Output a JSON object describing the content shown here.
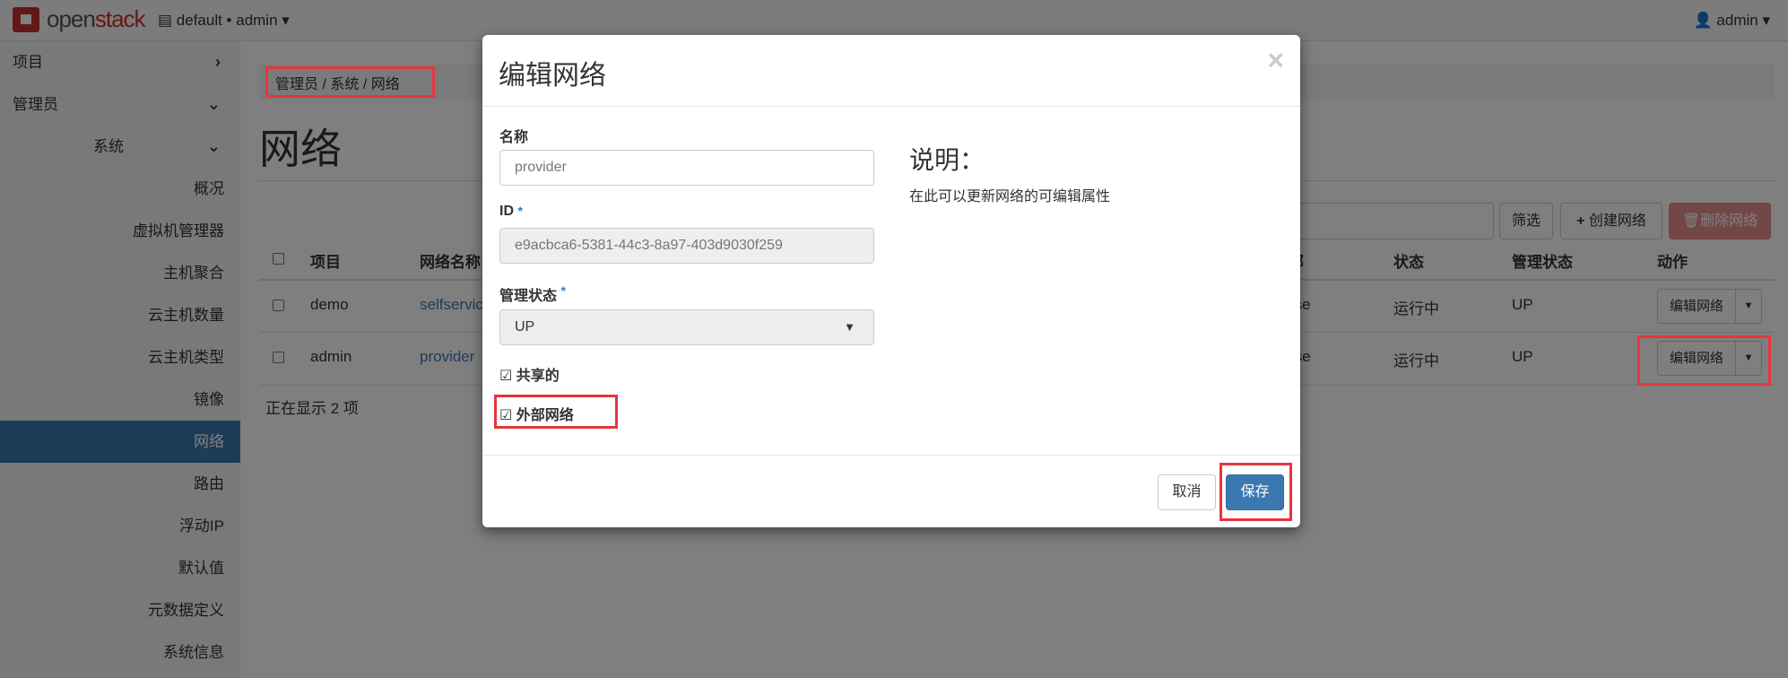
{
  "topbar": {
    "logo_a": "open",
    "logo_b": "stack",
    "project": "default • admin",
    "user": "admin"
  },
  "sidebar": {
    "items": [
      {
        "label": "项目",
        "chevron": ">"
      },
      {
        "label": "管理员",
        "chevron": "v"
      },
      {
        "label": "系统",
        "chevron": "v"
      },
      {
        "label": "概况"
      },
      {
        "label": "虚拟机管理器"
      },
      {
        "label": "主机聚合"
      },
      {
        "label": "云主机数量"
      },
      {
        "label": "云主机类型"
      },
      {
        "label": "镜像"
      },
      {
        "label": "网络",
        "active": true
      },
      {
        "label": "路由"
      },
      {
        "label": "浮动IP"
      },
      {
        "label": "默认值"
      },
      {
        "label": "元数据定义"
      },
      {
        "label": "系统信息"
      }
    ]
  },
  "breadcrumb": [
    "管理员",
    "系统",
    "网络"
  ],
  "page_title": "网络",
  "toolbar": {
    "filter": "筛选",
    "create": "创建网络",
    "delete": "删除网络"
  },
  "table": {
    "headers": [
      "项目",
      "网络名称",
      "外部",
      "状态",
      "管理状态",
      "动作"
    ],
    "rows": [
      {
        "project": "demo",
        "name": "selfservice",
        "external": "False",
        "status": "运行中",
        "admin_state": "UP",
        "action": "编辑网络"
      },
      {
        "project": "admin",
        "name": "provider",
        "external": "False",
        "status": "运行中",
        "admin_state": "UP",
        "action": "编辑网络"
      }
    ],
    "footer": "正在显示 2 项"
  },
  "modal": {
    "title": "编辑网络",
    "close": "×",
    "name_label": "名称",
    "name_value": "provider",
    "id_label": "ID",
    "id_value": "e9acbca6-5381-44c3-8a97-403d9030f259",
    "admin_label": "管理状态",
    "admin_value": "UP",
    "shared_label": "共享的",
    "shared": true,
    "external_label": "外部网络",
    "external": true,
    "desc_title": "说明：",
    "desc_text": "在此可以更新网络的可编辑属性",
    "cancel": "取消",
    "save": "保存"
  },
  "colors": {
    "primary": "#3a78b0",
    "danger": "#d9534f",
    "highlight": "#e8353a"
  }
}
